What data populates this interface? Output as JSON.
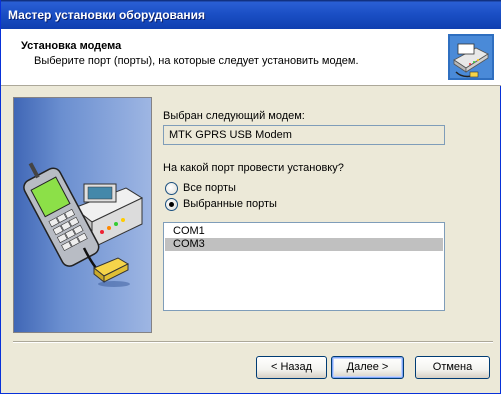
{
  "window": {
    "title": "Мастер установки оборудования"
  },
  "header": {
    "title": "Установка модема",
    "subtitle": "Выберите порт (порты), на которые следует установить модем."
  },
  "modem": {
    "label": "Выбран следующий модем:",
    "value": "MTK GPRS USB Modem"
  },
  "ports": {
    "question": "На какой порт провести установку?",
    "options": [
      {
        "label": "Все порты",
        "checked": false
      },
      {
        "label": "Выбранные порты",
        "checked": true
      }
    ],
    "list": [
      {
        "label": "COM1",
        "selected": false
      },
      {
        "label": "COM3",
        "selected": true
      }
    ]
  },
  "buttons": {
    "back": "< Назад",
    "next": "Далее >",
    "cancel": "Отмена"
  }
}
